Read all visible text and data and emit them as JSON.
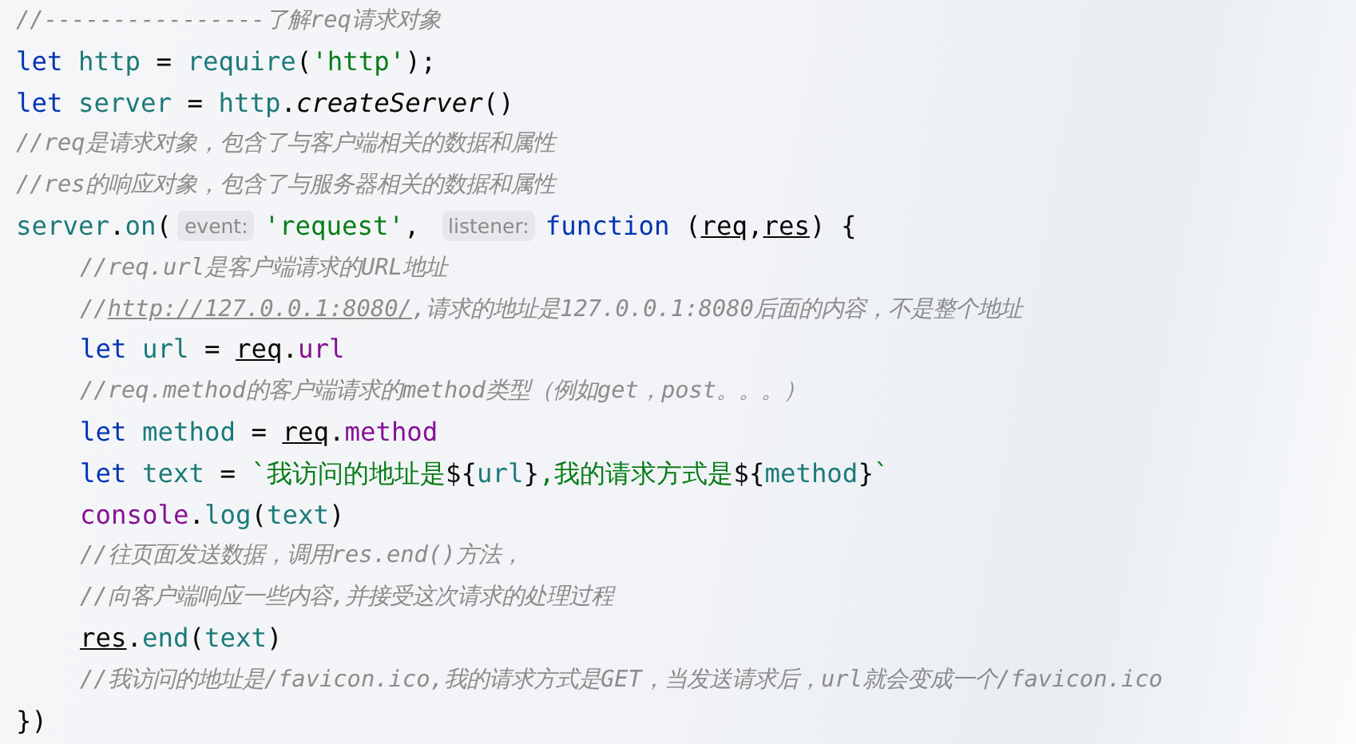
{
  "editor": {
    "lines": [
      {
        "tokens": [
          {
            "kind": "comment",
            "text": "//----------------了解req请求对象"
          }
        ]
      },
      {
        "tokens": [
          {
            "kind": "keyword",
            "text": "let"
          },
          {
            "kind": "variable",
            "text": "http"
          },
          {
            "kind": "plain",
            "text": " = "
          },
          {
            "kind": "variable",
            "text": "require"
          },
          {
            "kind": "plain",
            "text": "("
          },
          {
            "kind": "string",
            "text": "'http'"
          },
          {
            "kind": "plain",
            "text": ");"
          }
        ]
      },
      {
        "tokens": [
          {
            "kind": "keyword",
            "text": "let"
          },
          {
            "kind": "variable",
            "text": "server"
          },
          {
            "kind": "plain",
            "text": " = "
          },
          {
            "kind": "variable",
            "text": "http"
          },
          {
            "kind": "plain",
            "text": "."
          },
          {
            "kind": "method",
            "text": "createServer"
          },
          {
            "kind": "plain",
            "text": "()"
          }
        ]
      },
      {
        "tokens": [
          {
            "kind": "comment",
            "text": "//req是请求对象，包含了与客户端相关的数据和属性"
          }
        ]
      },
      {
        "tokens": [
          {
            "kind": "comment",
            "text": "//res的响应对象，包含了与服务器相关的数据和属性"
          }
        ]
      },
      {
        "tokens": [
          {
            "kind": "variable",
            "text": "server"
          },
          {
            "kind": "plain",
            "text": "."
          },
          {
            "kind": "variable",
            "text": "on"
          },
          {
            "kind": "plain",
            "text": "("
          },
          {
            "kind": "hint",
            "text": "event:"
          },
          {
            "kind": "string",
            "text": "'request'"
          },
          {
            "kind": "plain",
            "text": ", "
          },
          {
            "kind": "hint",
            "text": "listener:"
          },
          {
            "kind": "keyword",
            "text": "function"
          },
          {
            "kind": "plain",
            "text": "("
          },
          {
            "kind": "param",
            "text": "req"
          },
          {
            "kind": "plain",
            "text": ","
          },
          {
            "kind": "param",
            "text": "res"
          },
          {
            "kind": "plain",
            "text": ") {"
          }
        ],
        "children": [
          {
            "tokens": [
              {
                "kind": "comment",
                "text": "//req.url是客户端请求的URL地址"
              }
            ]
          },
          {
            "tokens": [
              {
                "kind": "comment",
                "text": "//"
              },
              {
                "kind": "link",
                "text": "http://127.0.0.1:8080/"
              },
              {
                "kind": "comment",
                "text": ",请求的地址是127.0.0.1:8080后面的内容，不是整个地址"
              }
            ]
          },
          {
            "tokens": [
              {
                "kind": "keyword",
                "text": "let"
              },
              {
                "kind": "variable",
                "text": "url"
              },
              {
                "kind": "plain",
                "text": " = "
              },
              {
                "kind": "param",
                "text": "req"
              },
              {
                "kind": "plain",
                "text": "."
              },
              {
                "kind": "property",
                "text": "url"
              }
            ]
          },
          {
            "tokens": [
              {
                "kind": "comment",
                "text": "//req.method的客户端请求的method类型（例如get，post。。。）"
              }
            ]
          },
          {
            "tokens": [
              {
                "kind": "keyword",
                "text": "let"
              },
              {
                "kind": "variable",
                "text": "method"
              },
              {
                "kind": "plain",
                "text": " = "
              },
              {
                "kind": "param",
                "text": "req"
              },
              {
                "kind": "plain",
                "text": "."
              },
              {
                "kind": "property",
                "text": "method"
              }
            ]
          },
          {
            "tokens": [
              {
                "kind": "keyword",
                "text": "let"
              },
              {
                "kind": "variable",
                "text": "text"
              },
              {
                "kind": "plain",
                "text": " = "
              },
              {
                "kind": "string",
                "text": "`我访问的地址是"
              },
              {
                "kind": "plain",
                "text": "${"
              },
              {
                "kind": "variable",
                "text": "url"
              },
              {
                "kind": "plain",
                "text": "}"
              },
              {
                "kind": "string",
                "text": ",我的请求方式是"
              },
              {
                "kind": "plain",
                "text": "${"
              },
              {
                "kind": "variable",
                "text": "method"
              },
              {
                "kind": "plain",
                "text": "}"
              },
              {
                "kind": "string",
                "text": "`"
              }
            ]
          },
          {
            "tokens": [
              {
                "kind": "property",
                "text": "console"
              },
              {
                "kind": "plain",
                "text": "."
              },
              {
                "kind": "variable",
                "text": "log"
              },
              {
                "kind": "plain",
                "text": "("
              },
              {
                "kind": "variable",
                "text": "text"
              },
              {
                "kind": "plain",
                "text": ")"
              }
            ]
          },
          {
            "tokens": [
              {
                "kind": "comment",
                "text": "//往页面发送数据，调用res.end()方法，"
              }
            ]
          },
          {
            "tokens": [
              {
                "kind": "comment",
                "text": "//向客户端响应一些内容,并接受这次请求的处理过程"
              }
            ]
          },
          {
            "tokens": [
              {
                "kind": "param",
                "text": "res"
              },
              {
                "kind": "plain",
                "text": "."
              },
              {
                "kind": "variable",
                "text": "end"
              },
              {
                "kind": "plain",
                "text": "("
              },
              {
                "kind": "variable",
                "text": "text"
              },
              {
                "kind": "plain",
                "text": ")"
              }
            ]
          },
          {
            "tokens": [
              {
                "kind": "comment",
                "text": "//我访问的地址是/favicon.ico,我的请求方式是GET，当发送请求后，url就会变成一个/favicon.ico"
              }
            ]
          }
        ]
      },
      {
        "tokens": [
          {
            "kind": "plain",
            "text": "})"
          }
        ]
      }
    ]
  }
}
